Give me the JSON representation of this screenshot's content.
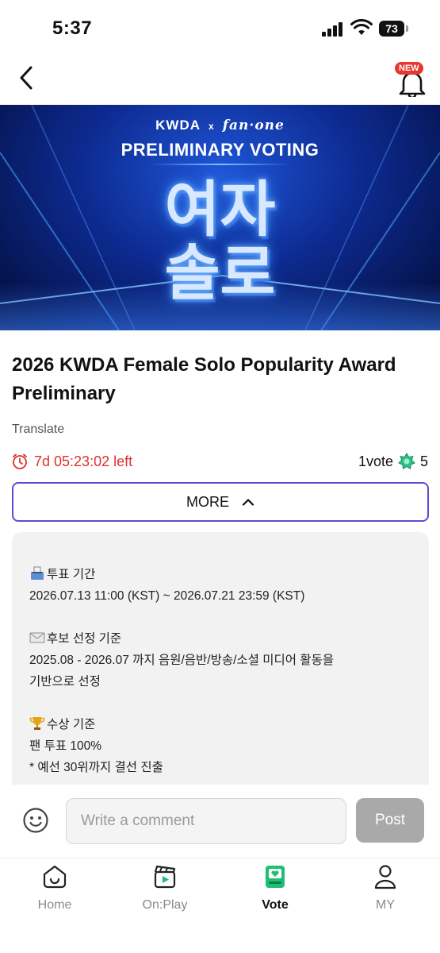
{
  "status_bar": {
    "time": "5:37",
    "battery": "73"
  },
  "header": {
    "new_badge": "NEW"
  },
  "banner": {
    "brand_left": "KWDA",
    "brand_x": "x",
    "brand_right": "fan·one",
    "title": "PRELIMINARY VOTING",
    "korean_line1": "여자",
    "korean_line2": "솔로"
  },
  "poll": {
    "title": "2026 KWDA Female Solo Popularity Award Preliminary",
    "translate_label": "Translate",
    "timer": "7d 05:23:02 left",
    "vote_label": "1vote",
    "vote_cost": "5",
    "more_label": "MORE"
  },
  "description": {
    "period_heading": "투표 기간",
    "period_value": "2026.07.13 11:00 (KST) ~ 2026.07.21 23:59 (KST)",
    "criteria_heading": "후보 선정 기준",
    "criteria_line1": "2025.08 - 2026.07 까지 음원/음반/방송/소셜 미디어 활동을",
    "criteria_line2": "기반으로 선정",
    "award_heading": "수상 기준",
    "award_line1": "팬 투표 100%",
    "award_line2": "* 예선 30위까지 결선 진출"
  },
  "comment": {
    "placeholder": "Write a comment",
    "post_label": "Post"
  },
  "nav": {
    "items": [
      {
        "label": "Home",
        "icon": "home-icon"
      },
      {
        "label": "On:Play",
        "icon": "clapperboard-icon"
      },
      {
        "label": "Vote",
        "icon": "vote-icon"
      },
      {
        "label": "MY",
        "icon": "person-icon"
      }
    ],
    "active_color": "#1dbf73",
    "inactive_color": "#8a8a8a"
  },
  "colors": {
    "accent_border": "#5b4bd6",
    "timer_red": "#e0302b",
    "badge_red": "#e8362e"
  }
}
